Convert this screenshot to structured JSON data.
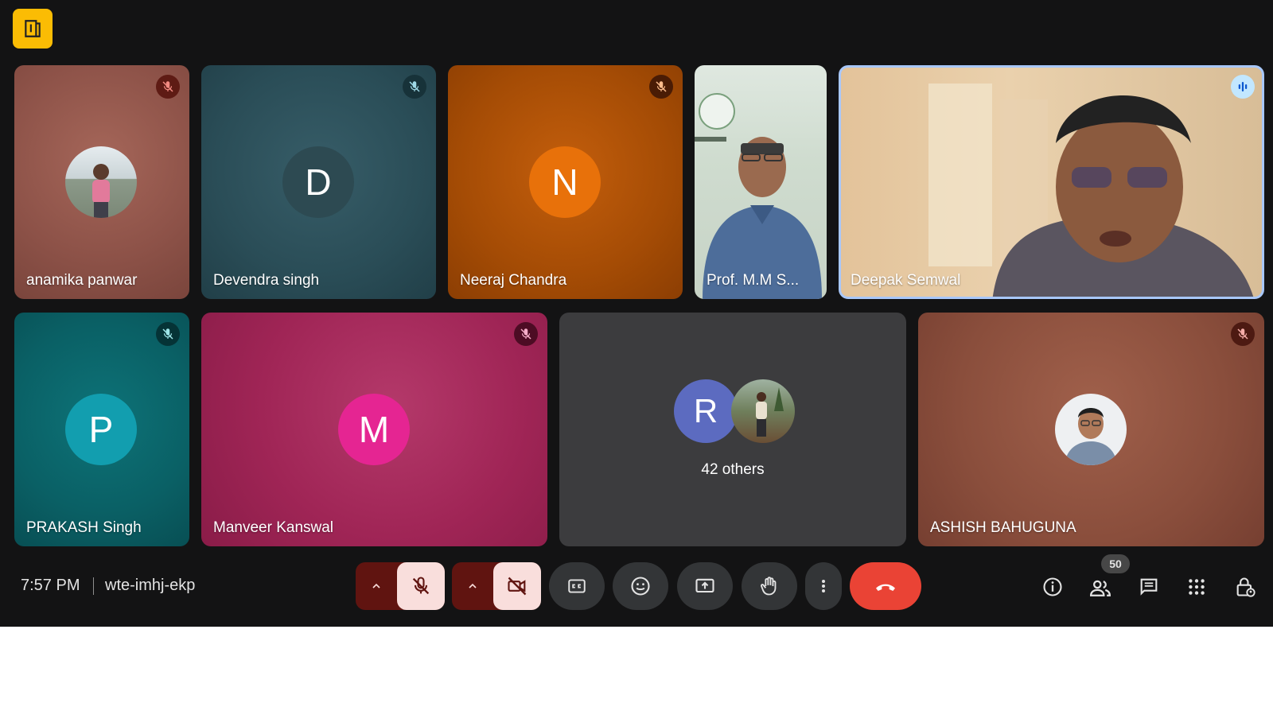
{
  "participants": {
    "anamika": {
      "name": "anamika panwar"
    },
    "devendra": {
      "name": "Devendra singh",
      "initial": "D"
    },
    "neeraj": {
      "name": "Neeraj Chandra",
      "initial": "N"
    },
    "mm": {
      "name": "Prof. M.M S..."
    },
    "deepak": {
      "name": "Deepak Semwal"
    },
    "prakash": {
      "name": "PRAKASH Singh",
      "initial": "P"
    },
    "manveer": {
      "name": "Manveer Kanswal",
      "initial": "M"
    },
    "others": {
      "initial": "R",
      "label": "42 others"
    },
    "ashish": {
      "name": "ASHISH BAHUGUNA"
    }
  },
  "toolbar": {
    "time": "7:57 PM",
    "meeting_code": "wte-imhj-ekp",
    "participant_count": "50"
  },
  "colors": {
    "accent_yellow": "#fbbc04",
    "end_call_red": "#ea4335",
    "muted_pink": "#f9dedc",
    "dark_red": "#601410",
    "speaking_border": "#a8c7fa"
  },
  "icons": [
    "exit-door-icon",
    "mic-off-icon",
    "speaking-icon",
    "chevron-up-icon",
    "videocam-off-icon",
    "captions-icon",
    "emoji-icon",
    "present-icon",
    "hand-icon",
    "more-vert-icon",
    "call-end-icon",
    "info-icon",
    "people-icon",
    "chat-icon",
    "apps-icon",
    "host-controls-icon"
  ]
}
